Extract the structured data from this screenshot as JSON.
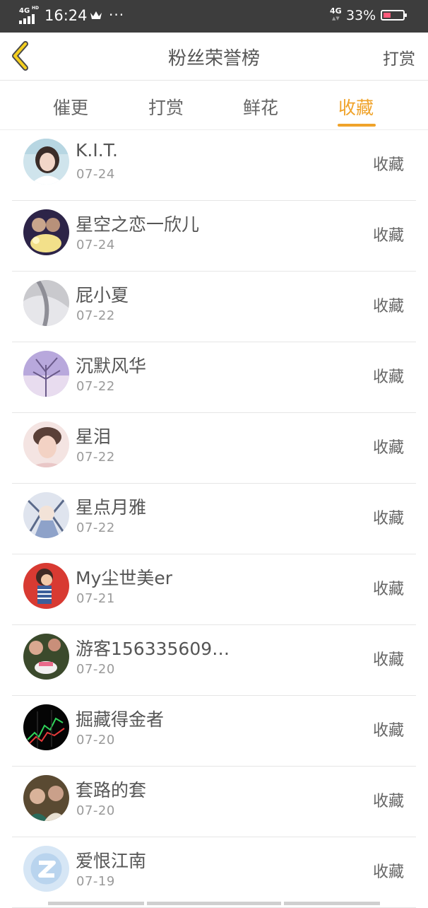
{
  "status_bar": {
    "network": "4G",
    "hd": "HD",
    "time": "16:24",
    "crown_icon": "crown-icon",
    "more": "···",
    "signal_right": "4G",
    "battery_text": "33%"
  },
  "nav": {
    "title": "粉丝荣誉榜",
    "right_action": "打赏"
  },
  "tabs": [
    {
      "label": "催更",
      "active": false
    },
    {
      "label": "打赏",
      "active": false
    },
    {
      "label": "鲜花",
      "active": false
    },
    {
      "label": "收藏",
      "active": true
    }
  ],
  "rows": [
    {
      "name": "K.I.T.",
      "date": "07-24",
      "action": "收藏"
    },
    {
      "name": "星空之恋一欣儿",
      "date": "07-24",
      "action": "收藏"
    },
    {
      "name": "屁小夏",
      "date": "07-22",
      "action": "收藏"
    },
    {
      "name": "沉默风华",
      "date": "07-22",
      "action": "收藏"
    },
    {
      "name": "星泪",
      "date": "07-22",
      "action": "收藏"
    },
    {
      "name": "星点月雅",
      "date": "07-22",
      "action": "收藏"
    },
    {
      "name": "My尘世美er",
      "date": "07-21",
      "action": "收藏"
    },
    {
      "name": "游客156335609…",
      "date": "07-20",
      "action": "收藏"
    },
    {
      "name": "掘藏得金者",
      "date": "07-20",
      "action": "收藏"
    },
    {
      "name": "套路的套",
      "date": "07-20",
      "action": "收藏"
    },
    {
      "name": "爱恨江南",
      "date": "07-19",
      "action": "收藏"
    }
  ],
  "colors": {
    "accent": "#f0a32a",
    "status_bar_bg": "#3d3d3d",
    "text_primary": "#555555",
    "text_secondary": "#9a9a9a"
  }
}
